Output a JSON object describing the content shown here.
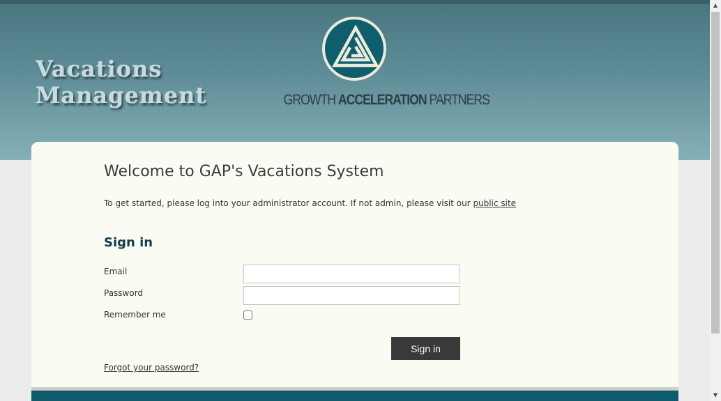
{
  "header": {
    "title_line1": "Vacations",
    "title_line2": "Management",
    "logo": {
      "icon": "triangle-spiral-logo-icon",
      "text_part1": "GROWTH ",
      "text_part2": "ACCELERATION",
      "text_part3": " PARTNERS"
    }
  },
  "main": {
    "title": "Welcome to GAP's Vacations System",
    "intro_text": "To get started, please log into your administrator account. If not admin, please visit our ",
    "intro_link": "public site"
  },
  "signin": {
    "heading": "Sign in",
    "email_label": "Email",
    "email_value": "",
    "password_label": "Password",
    "password_value": "",
    "remember_label": "Remember me",
    "remember_checked": false,
    "button_label": "Sign in",
    "forgot_link": "Forgot your password?"
  },
  "colors": {
    "header_top": "#4a7782",
    "header_bottom": "#86b0b8",
    "card_bg": "#fafbf3",
    "heading": "#0f3f4c",
    "button_bg": "#393939",
    "footer": "#0d5b6b"
  },
  "scrollbar": {
    "up_icon": "chevron-up-icon",
    "down_icon": "chevron-down-icon"
  }
}
